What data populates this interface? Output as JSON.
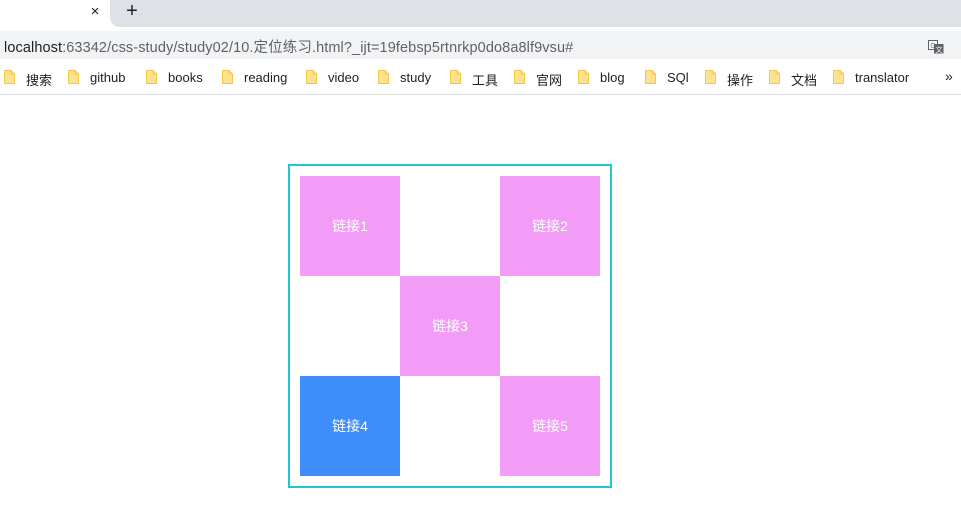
{
  "browser": {
    "tab_close_glyph": "×",
    "new_tab_glyph": "+",
    "url_host": "localhost",
    "url_rest": ":63342/css-study/study02/10.定位练习.html?_ijt=19febsp5rtnrkp0do8a8lf9vsu#",
    "bookmarks": [
      "搜索",
      "github",
      "books",
      "reading",
      "video",
      "study",
      "工具",
      "官网",
      "blog",
      "SQl",
      "操作",
      "文档",
      "translator"
    ],
    "bookmarks_more": "»"
  },
  "page": {
    "links": [
      "链接1",
      "链接2",
      "链接3",
      "链接4",
      "链接5"
    ],
    "active_link": "链接4",
    "colors": {
      "cell": "#f29cf7",
      "active_cell": "#3f8dfb",
      "border": "#22c4cf"
    }
  }
}
